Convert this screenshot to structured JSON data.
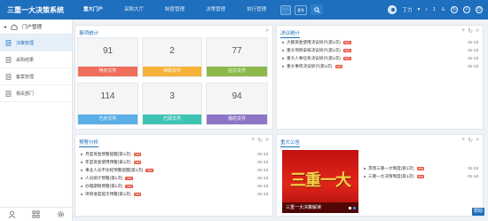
{
  "app": {
    "title": "三重一大决策系统"
  },
  "nav": {
    "items": [
      "重大门户",
      "采购大厅",
      "制度管理",
      "决策管理",
      "执行管理"
    ],
    "more": "···",
    "misc": "更多"
  },
  "user": {
    "name": "丁力",
    "count": "1"
  },
  "sidebar": {
    "header": "门户管理",
    "items": [
      {
        "label": "决策管理",
        "icon": "doc-icon"
      },
      {
        "label": "采购结果",
        "icon": "doc-icon"
      },
      {
        "label": "备案管理",
        "icon": "doc-icon"
      },
      {
        "label": "相关部门",
        "icon": "doc-icon"
      }
    ]
  },
  "work": {
    "title": "事项统计",
    "tiles": [
      {
        "num": "91",
        "label": "待办文件",
        "color": "#ef6f5c"
      },
      {
        "num": "2",
        "label": "待阅文件",
        "color": "#f5b23a"
      },
      {
        "num": "77",
        "label": "在办文件",
        "color": "#8cb94a"
      },
      {
        "num": "114",
        "label": "已办文件",
        "color": "#5aaee6"
      },
      {
        "num": "3",
        "label": "已阅文件",
        "color": "#3fc3b3"
      },
      {
        "num": "94",
        "label": "我的文件",
        "color": "#8e75c8"
      }
    ]
  },
  "decision": {
    "title": "决议统计",
    "items": [
      {
        "text": "大额资金使用决议统计(第1次)",
        "badge": "new",
        "date": "01-13"
      },
      {
        "text": "重大项目安排决议统计(第1次)",
        "badge": "new",
        "date": "01-13"
      },
      {
        "text": "重大人事任免决议统计(第1次)",
        "badge": "new",
        "date": "01-13"
      },
      {
        "text": "重大事项决议统计(第1次)",
        "badge": "new",
        "date": "01-13"
      }
    ]
  },
  "budget": {
    "title": "预警分析",
    "items": [
      {
        "text": "月度资金预警提醒(第1次)",
        "badge": "new",
        "date": "01-13"
      },
      {
        "text": "年度资金使用预警(第1次)",
        "badge": "new",
        "date": "01-13"
      },
      {
        "text": "事业人员不达标预警提醒(第1次)",
        "badge": "new",
        "date": "01-13"
      },
      {
        "text": "人员统计预警(第1次)",
        "badge": "new",
        "date": "01-13"
      },
      {
        "text": "办理期限预警(第1次)",
        "badge": "new",
        "date": "01-13"
      },
      {
        "text": "项目进度提示预警(第1次)",
        "badge": "new",
        "date": "01-13"
      }
    ]
  },
  "notice": {
    "title": "重大公告",
    "poster_title": "三重一大",
    "poster_caption": "三重一大决策解读",
    "items": [
      {
        "text": "贯彻三重一大制度(第1次)",
        "badge": "new",
        "date": "01-13"
      },
      {
        "text": "三重一大决策制度(第1次)",
        "badge": "new",
        "date": "01-13"
      }
    ]
  },
  "float": "帮助"
}
